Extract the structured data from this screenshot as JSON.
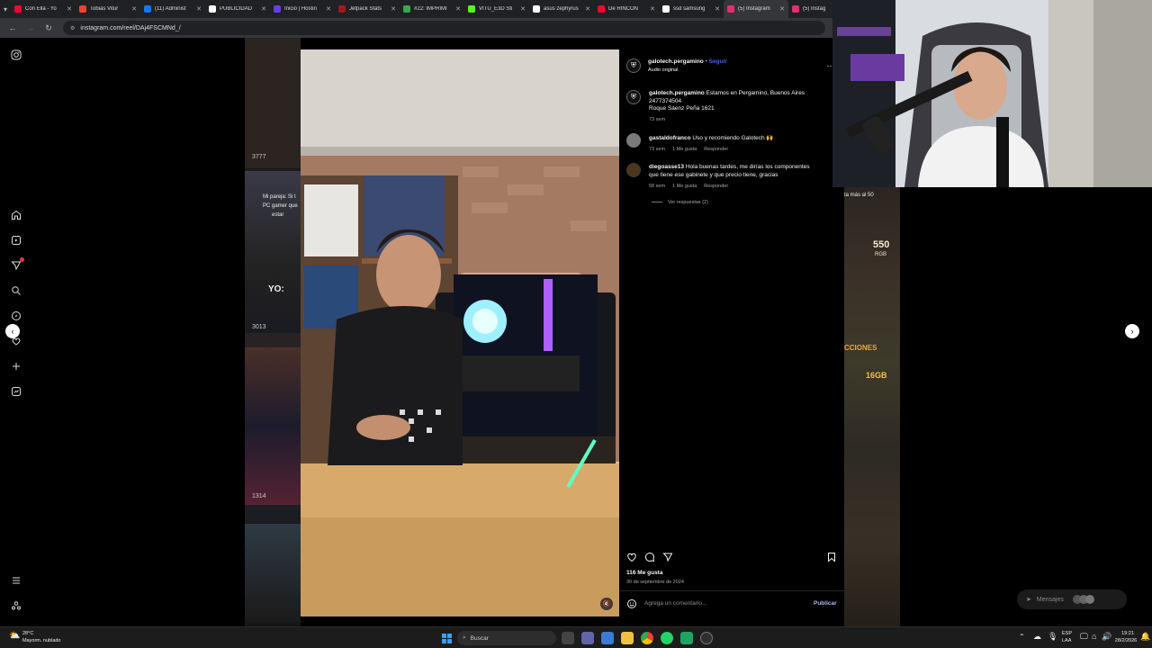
{
  "browser": {
    "tabs": [
      {
        "label": "Con Ella - Yo",
        "color": "#ff0033"
      },
      {
        "label": "Tobias Vitur",
        "color": "#ea4335"
      },
      {
        "label": "(11) Administ",
        "color": "#1877f2"
      },
      {
        "label": "PUBLICIDAD",
        "color": "#ffffff"
      },
      {
        "label": "Inicio | Hostin",
        "color": "#673de6"
      },
      {
        "label": "Jetpack Stats",
        "color": "#9b1c1c"
      },
      {
        "label": "#22: IMPRIMI",
        "color": "#34a853"
      },
      {
        "label": "VITU_E3D Sti",
        "color": "#53fc18"
      },
      {
        "label": "asus zephyrus",
        "color": "#ffffff"
      },
      {
        "label": "De RINCÓN",
        "color": "#ff0033"
      },
      {
        "label": "ssd samsung",
        "color": "#ffffff"
      },
      {
        "label": "(5) Instagram",
        "color": "#e1306c"
      },
      {
        "label": "(5) Instag",
        "color": "#e1306c"
      }
    ],
    "url": "instagram.com/reel/DAj4FSCMNd_/"
  },
  "background_reels": {
    "left_counts": [
      "3777",
      "3013",
      "1314"
    ],
    "left_texts": [
      "Mi pareja: Si t",
      "PC gamer que",
      "estar",
      "YO:"
    ],
    "right_texts": [
      "ta más al 50",
      "550",
      "RGB",
      "CCIONES",
      "16GB"
    ]
  },
  "post": {
    "username": "galotech.pergamino",
    "follow_label": "Seguir",
    "audio": "Audio original",
    "caption_user": "galotech.pergamino",
    "caption_lines": [
      "Estamos en Pergamino, Buenos Aires",
      "2477374504",
      "Roque Sáenz Peña 1621"
    ],
    "caption_time": "73 sem",
    "more_icon": "more-horizontal-icon"
  },
  "comments": [
    {
      "user": "gastaldofranco",
      "text": "Uso y recomiendo Galotech 🙌",
      "time": "73 sem",
      "likes": "1 Me gusta",
      "reply": "Responder"
    },
    {
      "user": "diegoasse13",
      "text": "Hola buenas tardes, me dirías los componentes",
      "text2": "que tiene ese gabinete y que precio tiene, gracias",
      "time": "58 sem",
      "likes": "1 Me gusta",
      "reply": "Responder",
      "view_replies": "Ver respuestas (2)"
    }
  ],
  "actions": {
    "likes": "116 Me gusta",
    "date": "30 de septiembre de 2024",
    "comment_placeholder": "Agrega un comentario...",
    "publish": "Publicar"
  },
  "messages_pill": "Mensajes",
  "taskbar": {
    "weather_temp": "28°C",
    "weather_desc": "Mayorm. nublado",
    "search": "Buscar",
    "lang1": "ESP",
    "lang2": "LAA",
    "time": "19:21",
    "date": "28/2/2026"
  },
  "colors": {
    "follow": "#4a5df9",
    "like_badge": "#ff3040"
  }
}
